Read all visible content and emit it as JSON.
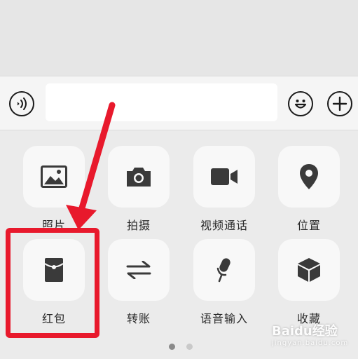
{
  "input_bar": {
    "text_value": "",
    "voice_icon": "voice-icon",
    "emoji_icon": "emoji-icon",
    "plus_icon": "plus-icon"
  },
  "panel": {
    "row1": [
      {
        "label": "照片",
        "icon": "photo-icon"
      },
      {
        "label": "拍摄",
        "icon": "camera-icon"
      },
      {
        "label": "视频通话",
        "icon": "video-call-icon"
      },
      {
        "label": "位置",
        "icon": "location-icon"
      }
    ],
    "row2": [
      {
        "label": "红包",
        "icon": "red-packet-icon"
      },
      {
        "label": "转账",
        "icon": "transfer-icon"
      },
      {
        "label": "语音输入",
        "icon": "microphone-icon"
      },
      {
        "label": "收藏",
        "icon": "favorites-icon"
      }
    ],
    "pages": {
      "count": 2,
      "current": 1
    }
  },
  "annotation": {
    "color": "#e8192c",
    "target": "红包"
  },
  "watermark": {
    "text": "Baidu经验",
    "sub": "jingyan.baidu.com"
  },
  "colors": {
    "icon": "#3a3a3a",
    "tile_bg": "#f8f8f8",
    "panel_bg": "#ebebeb"
  }
}
